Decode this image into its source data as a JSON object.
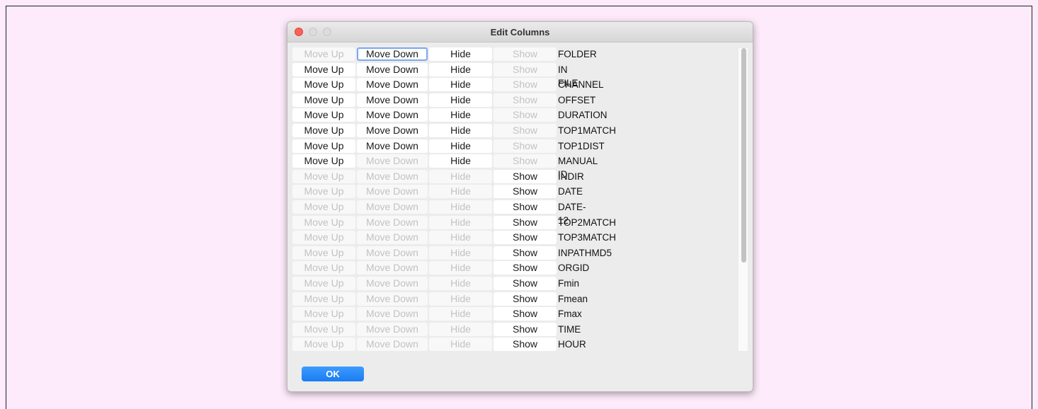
{
  "window": {
    "title": "Edit Columns"
  },
  "labels": {
    "move_up": "Move Up",
    "move_down": "Move Down",
    "hide": "Hide",
    "show": "Show",
    "ok": "OK"
  },
  "rows": [
    {
      "name": "FOLDER",
      "up": false,
      "down": true,
      "hide": true,
      "show": false,
      "focused": "down"
    },
    {
      "name": "IN FILE",
      "up": true,
      "down": true,
      "hide": true,
      "show": false
    },
    {
      "name": "CHANNEL",
      "up": true,
      "down": true,
      "hide": true,
      "show": false
    },
    {
      "name": "OFFSET",
      "up": true,
      "down": true,
      "hide": true,
      "show": false
    },
    {
      "name": "DURATION",
      "up": true,
      "down": true,
      "hide": true,
      "show": false
    },
    {
      "name": "TOP1MATCH",
      "up": true,
      "down": true,
      "hide": true,
      "show": false
    },
    {
      "name": "TOP1DIST",
      "up": true,
      "down": true,
      "hide": true,
      "show": false
    },
    {
      "name": "MANUAL ID",
      "up": true,
      "down": false,
      "hide": true,
      "show": false
    },
    {
      "name": "INDIR",
      "up": false,
      "down": false,
      "hide": false,
      "show": true
    },
    {
      "name": "DATE",
      "up": false,
      "down": false,
      "hide": false,
      "show": true
    },
    {
      "name": "DATE-12",
      "up": false,
      "down": false,
      "hide": false,
      "show": true
    },
    {
      "name": "TOP2MATCH",
      "up": false,
      "down": false,
      "hide": false,
      "show": true
    },
    {
      "name": "TOP3MATCH",
      "up": false,
      "down": false,
      "hide": false,
      "show": true
    },
    {
      "name": "INPATHMD5",
      "up": false,
      "down": false,
      "hide": false,
      "show": true
    },
    {
      "name": "ORGID",
      "up": false,
      "down": false,
      "hide": false,
      "show": true
    },
    {
      "name": "Fmin",
      "up": false,
      "down": false,
      "hide": false,
      "show": true
    },
    {
      "name": "Fmean",
      "up": false,
      "down": false,
      "hide": false,
      "show": true
    },
    {
      "name": "Fmax",
      "up": false,
      "down": false,
      "hide": false,
      "show": true
    },
    {
      "name": "TIME",
      "up": false,
      "down": false,
      "hide": false,
      "show": true
    },
    {
      "name": "HOUR",
      "up": false,
      "down": false,
      "hide": false,
      "show": true
    }
  ],
  "colors": {
    "accent": "#1a7df0",
    "close": "#fe5f57",
    "disabled_text": "#c2c2c2",
    "focus_ring": "#7aa9ee",
    "background": "#fdeafa"
  }
}
